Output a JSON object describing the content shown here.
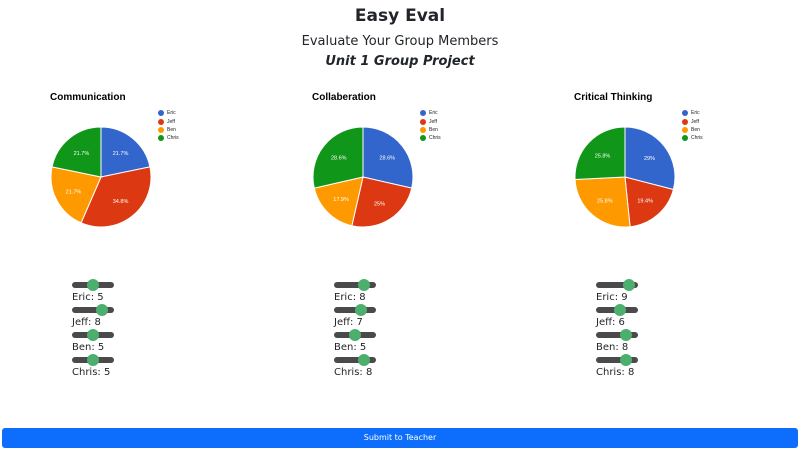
{
  "header": {
    "title": "Easy Eval",
    "subtitle": "Evaluate Your Group Members",
    "project": "Unit 1 Group Project"
  },
  "colors": {
    "Eric": "#3366cc",
    "Jeff": "#dc3912",
    "Ben": "#ff9900",
    "Chris": "#109618",
    "slider_track": "#4a4a4a",
    "slider_thumb": "#4caf6e",
    "submit_button": "#0d6efd"
  },
  "members": [
    "Eric",
    "Jeff",
    "Ben",
    "Chris"
  ],
  "chart_data": [
    {
      "type": "pie",
      "title": "Communication",
      "labels": [
        "Eric",
        "Jeff",
        "Ben",
        "Chris"
      ],
      "values": [
        5,
        8,
        5,
        5
      ],
      "slice_labels": [
        "21.7%",
        "34.8%",
        "21.7%",
        "21.7%"
      ],
      "legend": "right"
    },
    {
      "type": "pie",
      "title": "Collaberation",
      "labels": [
        "Eric",
        "Jeff",
        "Ben",
        "Chris"
      ],
      "values": [
        8,
        7,
        5,
        8
      ],
      "slice_labels": [
        "28.6%",
        "25%",
        "17.9%",
        "28.6%"
      ],
      "legend": "right"
    },
    {
      "type": "pie",
      "title": "Critical Thinking",
      "labels": [
        "Eric",
        "Jeff",
        "Ben",
        "Chris"
      ],
      "values": [
        9,
        6,
        8,
        8
      ],
      "slice_labels": [
        "29%",
        "19.4%",
        "25.8%",
        "25.8%"
      ],
      "legend": "right"
    }
  ],
  "sliders": [
    {
      "category": "Communication",
      "items": [
        {
          "label": "Eric: 5",
          "value": 5
        },
        {
          "label": "Jeff: 8",
          "value": 8
        },
        {
          "label": "Ben: 5",
          "value": 5
        },
        {
          "label": "Chris: 5",
          "value": 5
        }
      ]
    },
    {
      "category": "Collaberation",
      "items": [
        {
          "label": "Eric: 8",
          "value": 8
        },
        {
          "label": "Jeff: 7",
          "value": 7
        },
        {
          "label": "Ben: 5",
          "value": 5
        },
        {
          "label": "Chris: 8",
          "value": 8
        }
      ]
    },
    {
      "category": "Critical Thinking",
      "items": [
        {
          "label": "Eric: 9",
          "value": 9
        },
        {
          "label": "Jeff: 6",
          "value": 6
        },
        {
          "label": "Ben: 8",
          "value": 8
        },
        {
          "label": "Chris: 8",
          "value": 8
        }
      ]
    }
  ],
  "slider_range": [
    0,
    10
  ],
  "submit_label": "Submit to Teacher"
}
